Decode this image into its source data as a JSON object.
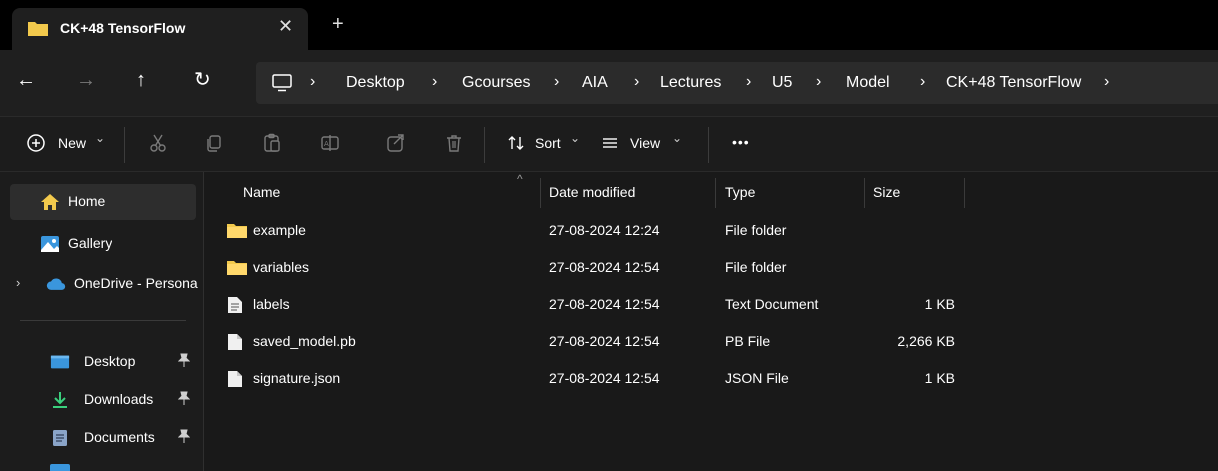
{
  "tab": {
    "title": "CK+48 TensorFlow",
    "close_glyph": "✕",
    "new_tab_glyph": "+"
  },
  "nav": {
    "back_glyph": "←",
    "forward_glyph": "→",
    "up_glyph": "↑",
    "refresh_glyph": "↻"
  },
  "breadcrumb": {
    "separator": "›",
    "items": [
      "Desktop",
      "Gcourses",
      "AIA",
      "Lectures",
      "U5",
      "Model",
      "CK+48 TensorFlow"
    ]
  },
  "toolbar": {
    "new_label": "New",
    "sort_label": "Sort",
    "view_label": "View",
    "more_label": "•••",
    "chevron": "⌄"
  },
  "sidebar": {
    "items": [
      {
        "label": "Home",
        "icon": "home-icon"
      },
      {
        "label": "Gallery",
        "icon": "gallery-icon"
      },
      {
        "label": "OneDrive - Persona",
        "icon": "onedrive-icon"
      },
      {
        "label": "Desktop",
        "icon": "desktop-folder-icon"
      },
      {
        "label": "Downloads",
        "icon": "downloads-icon"
      },
      {
        "label": "Documents",
        "icon": "documents-icon"
      }
    ],
    "pin_glyph": "📌",
    "expand_glyph": "›"
  },
  "columns": {
    "name": "Name",
    "date": "Date modified",
    "type": "Type",
    "size": "Size",
    "sort_caret": "^"
  },
  "files": [
    {
      "name": "example",
      "date": "27-08-2024 12:24",
      "type": "File folder",
      "size": "",
      "icon": "folder-icon"
    },
    {
      "name": "variables",
      "date": "27-08-2024 12:54",
      "type": "File folder",
      "size": "",
      "icon": "folder-icon"
    },
    {
      "name": "labels",
      "date": "27-08-2024 12:54",
      "type": "Text Document",
      "size": "1 KB",
      "icon": "text-document-icon"
    },
    {
      "name": "saved_model.pb",
      "date": "27-08-2024 12:54",
      "type": "PB File",
      "size": "2,266 KB",
      "icon": "file-icon"
    },
    {
      "name": "signature.json",
      "date": "27-08-2024 12:54",
      "type": "JSON File",
      "size": "1 KB",
      "icon": "file-icon"
    }
  ],
  "colors": {
    "folder": "#f2c94c",
    "accent": "#0078d4"
  }
}
